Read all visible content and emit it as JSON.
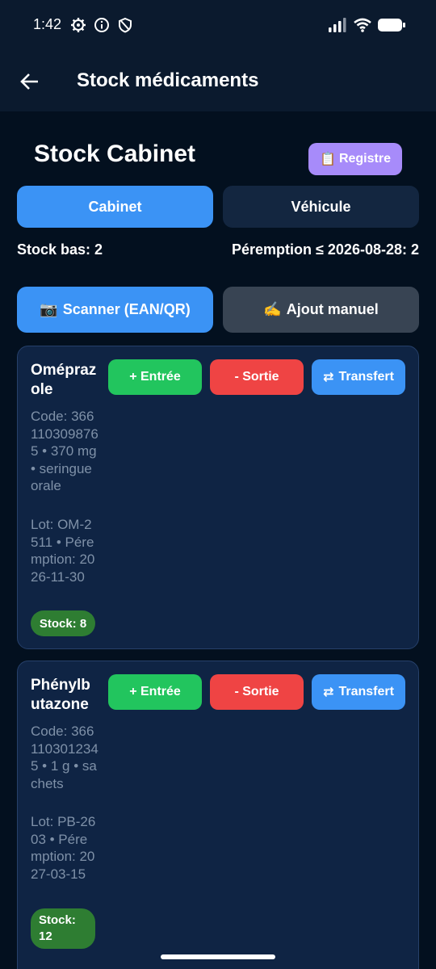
{
  "status_bar": {
    "time": "1:42",
    "left_icons": [
      "gear-icon",
      "info-icon",
      "shield-icon"
    ],
    "right_icons": [
      "signal-icon",
      "wifi-icon",
      "battery-icon"
    ]
  },
  "app_bar": {
    "back_icon": "arrow-left-icon",
    "title": "Stock médicaments"
  },
  "header": {
    "title": "Stock Cabinet",
    "registre_icon": "📋",
    "registre_label": "Registre"
  },
  "segments": [
    {
      "label": "Cabinet",
      "selected": true
    },
    {
      "label": "Véhicule",
      "selected": false
    }
  ],
  "stats": {
    "low_stock": "Stock bas: 2",
    "expiry": "Péremption ≤ 2026-08-28: 2"
  },
  "actions": {
    "scan_icon": "📷",
    "scan_label": "Scanner (EAN/QR)",
    "manual_icon": "✍️",
    "manual_label": "Ajout manuel"
  },
  "card_buttons": {
    "in_label": "+ Entrée",
    "out_label": "- Sortie",
    "transfer_icon": "⇄",
    "transfer_label": "Transfert"
  },
  "medications": [
    {
      "name": "Oméprazole",
      "details": "Code: 3661103098765 • 370 mg • seringue orale",
      "lot": "Lot: OM-2511 • Péremption: 2026-11-30",
      "stock": "Stock: 8"
    },
    {
      "name": "Phénylbutazone",
      "details": "Code: 3661103012345 • 1 g • sachets",
      "lot": "Lot: PB-2603 • Péremption: 2027-03-15",
      "stock": "Stock: 12"
    }
  ],
  "colors": {
    "background": "#03101f",
    "bar": "#0b1a2e",
    "primary": "#3b93f5",
    "purple": "#a78bfa",
    "green": "#22c55e",
    "red": "#ef4444",
    "badge_green": "#2e7d32",
    "card": "#0f2444"
  }
}
